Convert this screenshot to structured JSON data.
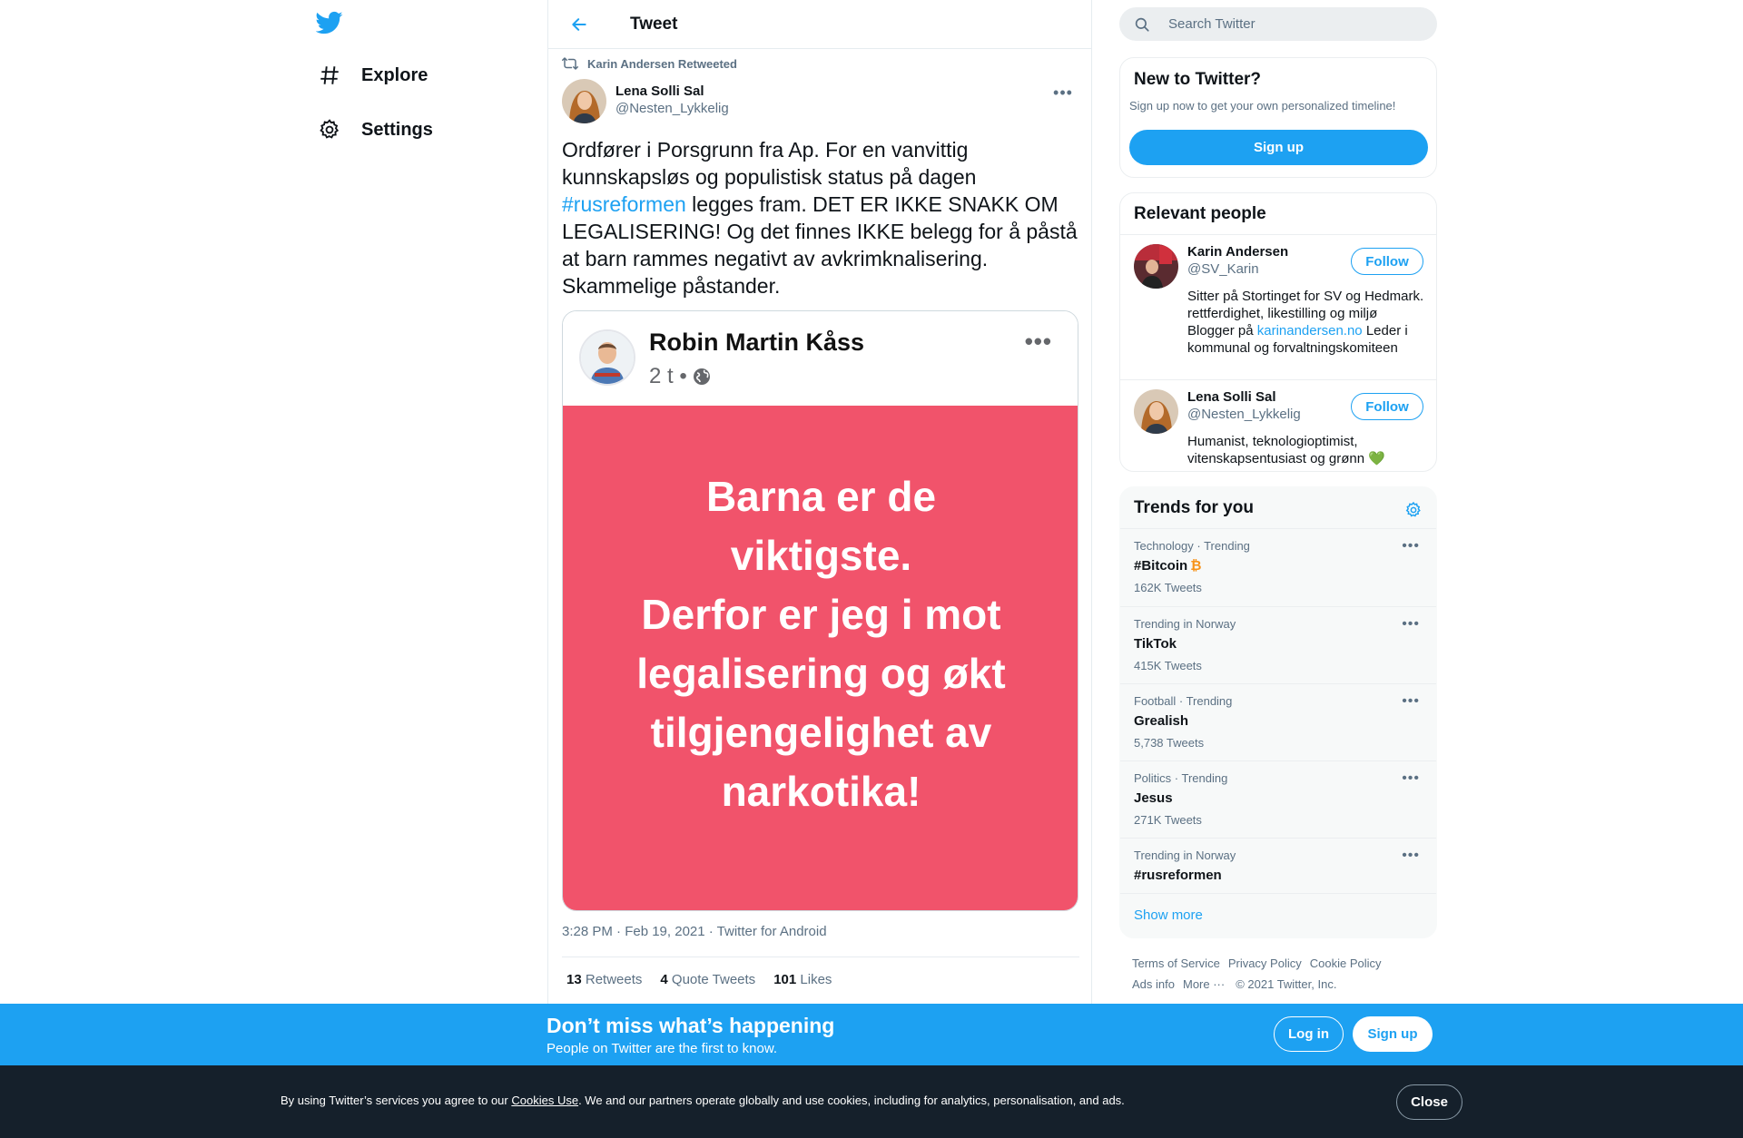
{
  "colors": {
    "accent": "#1da1f2",
    "text_primary": "#0f1419",
    "text_secondary": "#5b7083",
    "fb_post_background": "#f1536b",
    "cookie_bar": "#15202b",
    "bitcoin": "#f7931a"
  },
  "nav": {
    "logo_icon": "twitter-bird-icon",
    "items": [
      {
        "label": "Explore",
        "icon": "hashtag-icon"
      },
      {
        "label": "Settings",
        "icon": "gear-icon"
      }
    ]
  },
  "header": {
    "title": "Tweet",
    "back_icon": "arrow-left-icon"
  },
  "tweet": {
    "retweeted_by": "Karin Andersen Retweeted",
    "author_name": "Lena Solli Sal",
    "author_handle": "@Nesten_Lykkelig",
    "text_before": "Ordfører i Porsgrunn fra Ap. For en vanvittig kunnskapsløs og populistisk status på dagen ",
    "hashtag": "#rusreformen",
    "text_after": " legges fram. DET ER IKKE SNAKK OM LEGALISERING! Og det finnes IKKE belegg for å påstå at barn rammes negativt av avkrimknalisering. Skammelige påstander.",
    "timestamp": "3:28 PM · Feb 19, 2021",
    "separator": " · ",
    "source": "Twitter for Android",
    "stats": {
      "retweets_count": "13",
      "retweets_label": "Retweets",
      "quotes_count": "4",
      "quotes_label": "Quote Tweets",
      "likes_count": "101",
      "likes_label": "Likes"
    }
  },
  "media": {
    "poster_name": "Robin Martin Kåss",
    "post_time": "2 t •",
    "post_dots": "•••",
    "post_text": [
      "Barna er de",
      "viktigste.",
      "Derfor er jeg i mot",
      "legalisering og økt",
      "tilgjengelighet av",
      "narkotika!"
    ]
  },
  "search": {
    "placeholder": "Search Twitter"
  },
  "new_to_twitter": {
    "title": "New to Twitter?",
    "subtitle": "Sign up now to get your own personalized timeline!",
    "button": "Sign up"
  },
  "relevant_people": {
    "title": "Relevant people",
    "people": [
      {
        "name": "Karin Andersen",
        "handle": "@SV_Karin",
        "bio_before": "Sitter på Stortinget for SV og Hedmark. rettferdighet, likestilling og miljø Blogger på ",
        "bio_link": "karinandersen.no",
        "bio_after": " Leder i kommunal og forvaltningskomiteen",
        "follow": "Follow"
      },
      {
        "name": "Lena Solli Sal",
        "handle": "@Nesten_Lykkelig",
        "bio_before": "Humanist, teknologioptimist, vitenskapsentusiast og grønn ",
        "bio_emoji": "💚",
        "follow": "Follow"
      }
    ]
  },
  "trends": {
    "title": "Trends for you",
    "items": [
      {
        "context": "Technology · Trending",
        "name": "#Bitcoin",
        "emoji": "₿",
        "count": "162K Tweets"
      },
      {
        "context": "Trending in Norway",
        "name": "TikTok",
        "count": "415K Tweets"
      },
      {
        "context": "Football · Trending",
        "name": "Grealish",
        "count": "5,738 Tweets"
      },
      {
        "context": "Politics · Trending",
        "name": "Jesus",
        "count": "271K Tweets"
      },
      {
        "context": "Trending in Norway",
        "name": "#rusreformen",
        "count": ""
      }
    ],
    "show_more": "Show more"
  },
  "footer": {
    "terms": "Terms of Service",
    "privacy": "Privacy Policy",
    "cookie": "Cookie Policy",
    "ads": "Ads info",
    "more": "More ···",
    "copyright": "© 2021 Twitter, Inc."
  },
  "dont_miss": {
    "title": "Don’t miss what’s happening",
    "subtitle": "People on Twitter are the first to know.",
    "login": "Log in",
    "signup": "Sign up"
  },
  "cookie_bar": {
    "text_before": "By using Twitter’s services you agree to our ",
    "link": "Cookies Use",
    "text_after": ". We and our partners operate globally and use cookies, including for analytics, personalisation, and ads.",
    "close": "Close"
  }
}
